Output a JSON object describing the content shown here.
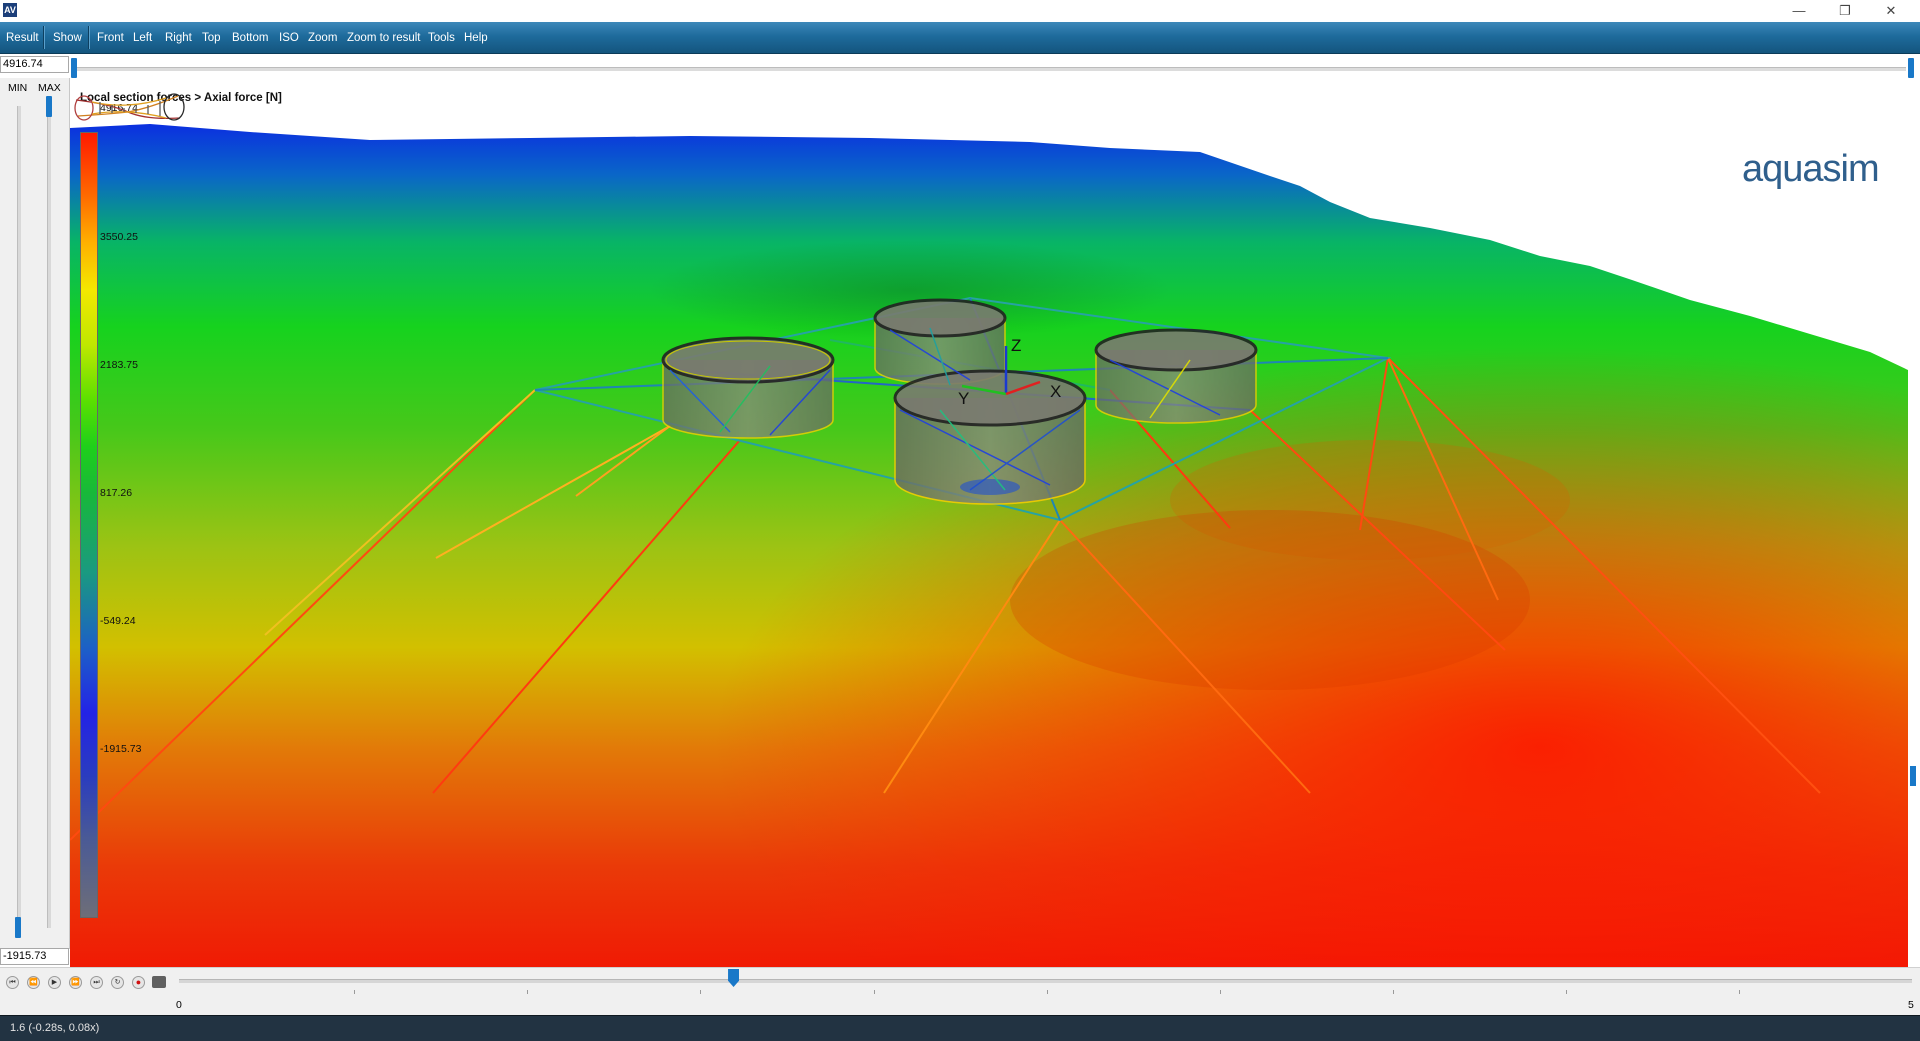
{
  "window": {
    "app_icon_text": "AV",
    "controls": {
      "minimize": "—",
      "restore": "❐",
      "close": "✕"
    }
  },
  "menubar": {
    "left_items": [
      "Result",
      "Show"
    ],
    "view_items": [
      "Front",
      "Left",
      "Right",
      "Top",
      "Bottom",
      "ISO",
      "Zoom",
      "Zoom to result",
      "Tools",
      "Help"
    ]
  },
  "range": {
    "max_value": "4916.74",
    "min_value": "-1915.73",
    "min_label": "MIN",
    "max_label": "MAX"
  },
  "viewport": {
    "title": "Local section forces > Axial force [N]",
    "scale_labels": [
      "4916.74",
      "3550.25",
      "2183.75",
      "817.26",
      "-549.24",
      "-1915.73"
    ],
    "axes": {
      "z": "Z",
      "y": "Y",
      "x": "X"
    },
    "logo": "aquasim"
  },
  "playback": {
    "buttons": [
      "skip-start",
      "step-back",
      "play",
      "step-forward",
      "skip-end",
      "loop",
      "record"
    ],
    "glyphs": [
      "⏮",
      "⏪",
      "▶",
      "⏩",
      "⏭",
      "↻",
      "●"
    ],
    "time_start": "0",
    "time_end": "5",
    "position_fraction": 0.32
  },
  "status": {
    "text": "1.6 (-0.28s, 0.08x)"
  },
  "colors": {
    "menubar": "#1e6b9c",
    "accent": "#1978c8",
    "statusbar": "#223342",
    "logo": "#2f5f8c"
  }
}
